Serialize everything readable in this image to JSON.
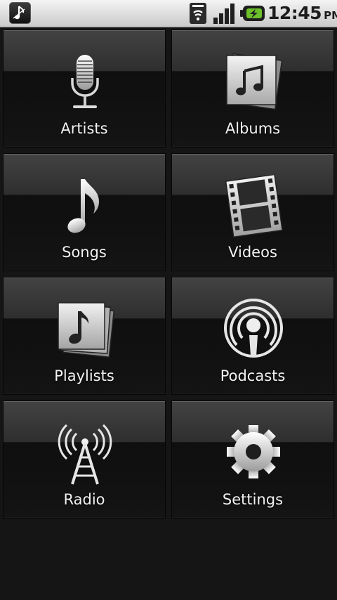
{
  "status_bar": {
    "time": "12:45",
    "ampm": "PM",
    "icons": [
      "music-notification-icon",
      "sd-card-icon",
      "signal-strength-icon",
      "battery-charging-icon"
    ]
  },
  "tiles": [
    {
      "label": "Artists",
      "icon": "microphone-icon"
    },
    {
      "label": "Albums",
      "icon": "album-icon"
    },
    {
      "label": "Songs",
      "icon": "music-note-icon"
    },
    {
      "label": "Videos",
      "icon": "film-strip-icon"
    },
    {
      "label": "Playlists",
      "icon": "playlist-icon"
    },
    {
      "label": "Podcasts",
      "icon": "podcast-icon"
    },
    {
      "label": "Radio",
      "icon": "radio-tower-icon"
    },
    {
      "label": "Settings",
      "icon": "gear-icon"
    }
  ],
  "colors": {
    "background": "#151515",
    "tile_label": "#f2f2f2",
    "status_bar": "#dcdcdc"
  }
}
